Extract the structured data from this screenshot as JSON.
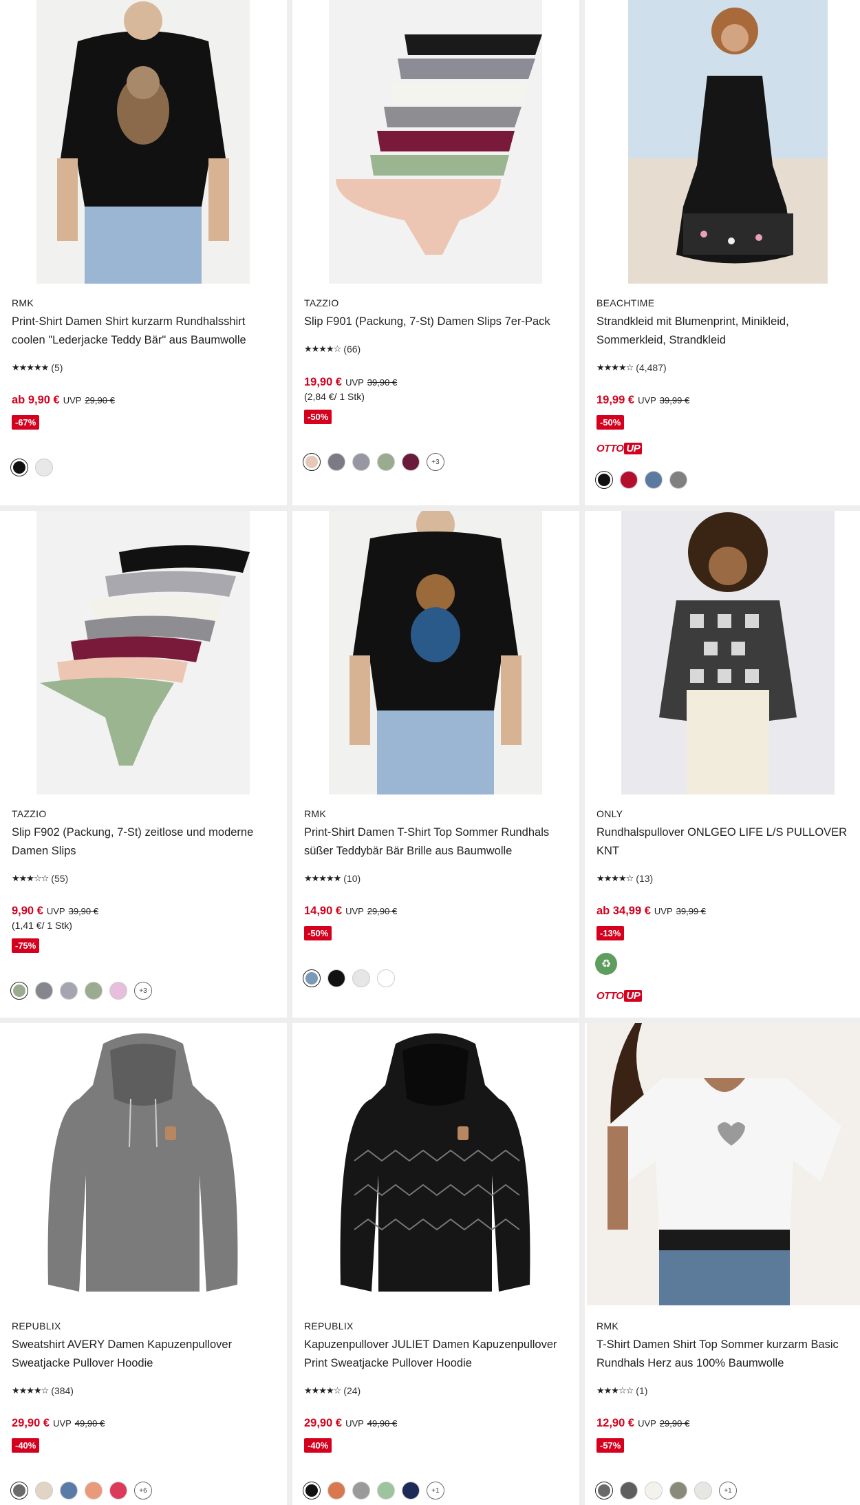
{
  "colors": {
    "price_red": "#d4001e",
    "badge_red": "#d4001e",
    "eco_green": "#5f9d5f"
  },
  "products": [
    {
      "brand": "RMK",
      "title": "Print-Shirt Damen Shirt kurzarm Rundhalsshirt coolen \"Lederjacke Teddy Bär\" aus Baumwolle",
      "stars": "★★★★★",
      "rating": 4.5,
      "reviews": "(5)",
      "price": "ab 9,90 €",
      "uvp": "UVP",
      "old_price": "29,90 €",
      "discount": "-67%",
      "colors": [
        "#111111",
        "#e8e8e8"
      ]
    },
    {
      "brand": "TAZZIO",
      "title": "Slip F901 (Packung, 7-St) Damen Slips 7er-Pack",
      "stars": "★★★★☆",
      "rating": 3.5,
      "reviews": "(66)",
      "price": "19,90 €",
      "uvp": "UVP",
      "old_price": "39,90 €",
      "unit_price": "(2,84 €/ 1 Stk)",
      "discount": "-50%",
      "colors": [
        "#e6c8b8",
        "#7b7b85",
        "#9797a4",
        "#9aab90",
        "#6a1a3a"
      ],
      "more": "+3"
    },
    {
      "brand": "BEACHTIME",
      "title": "Strandkleid mit Blumenprint, Minikleid, Sommerkleid, Strandkleid",
      "stars": "★★★★☆",
      "rating": 4,
      "reviews": "(4,487)",
      "price": "19,99 €",
      "uvp": "UVP",
      "old_price": "39,99 €",
      "discount": "-50%",
      "ottoup": {
        "otto": "OTTO",
        "up": "UP"
      },
      "colors": [
        "#111111",
        "#b4102e",
        "#5a7aa0",
        "#808080"
      ]
    },
    {
      "brand": "TAZZIO",
      "title": "Slip F902 (Packung, 7-St) zeitlose und moderne Damen Slips",
      "stars": "★★★☆☆",
      "rating": 3,
      "reviews": "(55)",
      "price": "9,90 €",
      "uvp": "UVP",
      "old_price": "39,90 €",
      "unit_price": "(1,41 €/ 1 Stk)",
      "discount": "-75%",
      "colors": [
        "#9aab90",
        "#86868e",
        "#a5a5b2",
        "#9aab90",
        "#e8bedd"
      ],
      "more": "+3"
    },
    {
      "brand": "RMK",
      "title": "Print-Shirt Damen T-Shirt Top Sommer Rundhals süßer Teddybär Bär Brille aus Baumwolle",
      "stars": "★★★★★",
      "rating": 4.5,
      "reviews": "(10)",
      "price": "14,90 €",
      "uvp": "UVP",
      "old_price": "29,90 €",
      "discount": "-50%",
      "colors": [
        "#7a9ab8",
        "#111111",
        "#e6e6e6",
        "#ffffff"
      ]
    },
    {
      "brand": "ONLY",
      "title": "Rundhalspullover ONLGEO LIFE L/S PULLOVER KNT",
      "stars": "★★★★☆",
      "rating": 4,
      "reviews": "(13)",
      "price": "ab 34,99 €",
      "uvp": "UVP",
      "old_price": "39,99 €",
      "discount": "-13%",
      "eco": true,
      "ottoup": {
        "otto": "OTTO",
        "up": "UP"
      },
      "colors": []
    },
    {
      "brand": "REPUBLIX",
      "title": "Sweatshirt AVERY Damen Kapuzenpullover Sweatjacke Pullover Hoodie",
      "stars": "★★★★☆",
      "rating": 4,
      "reviews": "(384)",
      "price": "29,90 €",
      "uvp": "UVP",
      "old_price": "49,90 €",
      "discount": "-40%",
      "colors": [
        "#6b6b6b",
        "#e2d4c4",
        "#5a7aa8",
        "#ea9a78",
        "#dc3a5a"
      ],
      "more": "+6"
    },
    {
      "brand": "REPUBLIX",
      "title": "Kapuzenpullover JULIET Damen Kapuzenpullover Print Sweatjacke Pullover Hoodie",
      "stars": "★★★★☆",
      "rating": 4,
      "reviews": "(24)",
      "price": "29,90 €",
      "uvp": "UVP",
      "old_price": "49,90 €",
      "discount": "-40%",
      "colors": [
        "#111111",
        "#d9784f",
        "#9a9a9a",
        "#9ec49e",
        "#1c2a58"
      ],
      "more": "+1"
    },
    {
      "brand": "RMK",
      "title": "T-Shirt Damen Shirt Top Sommer kurzarm Basic Rundhals Herz aus 100% Baumwolle",
      "stars": "★★★☆☆",
      "rating": 3,
      "reviews": "(1)",
      "price": "12,90 €",
      "uvp": "UVP",
      "old_price": "29,90 €",
      "discount": "-57%",
      "colors": [
        "#6a6a6a",
        "#5e5e5e",
        "#f4f2ec",
        "#8a8a7a",
        "#e8e6e2"
      ],
      "more": "+1"
    }
  ]
}
